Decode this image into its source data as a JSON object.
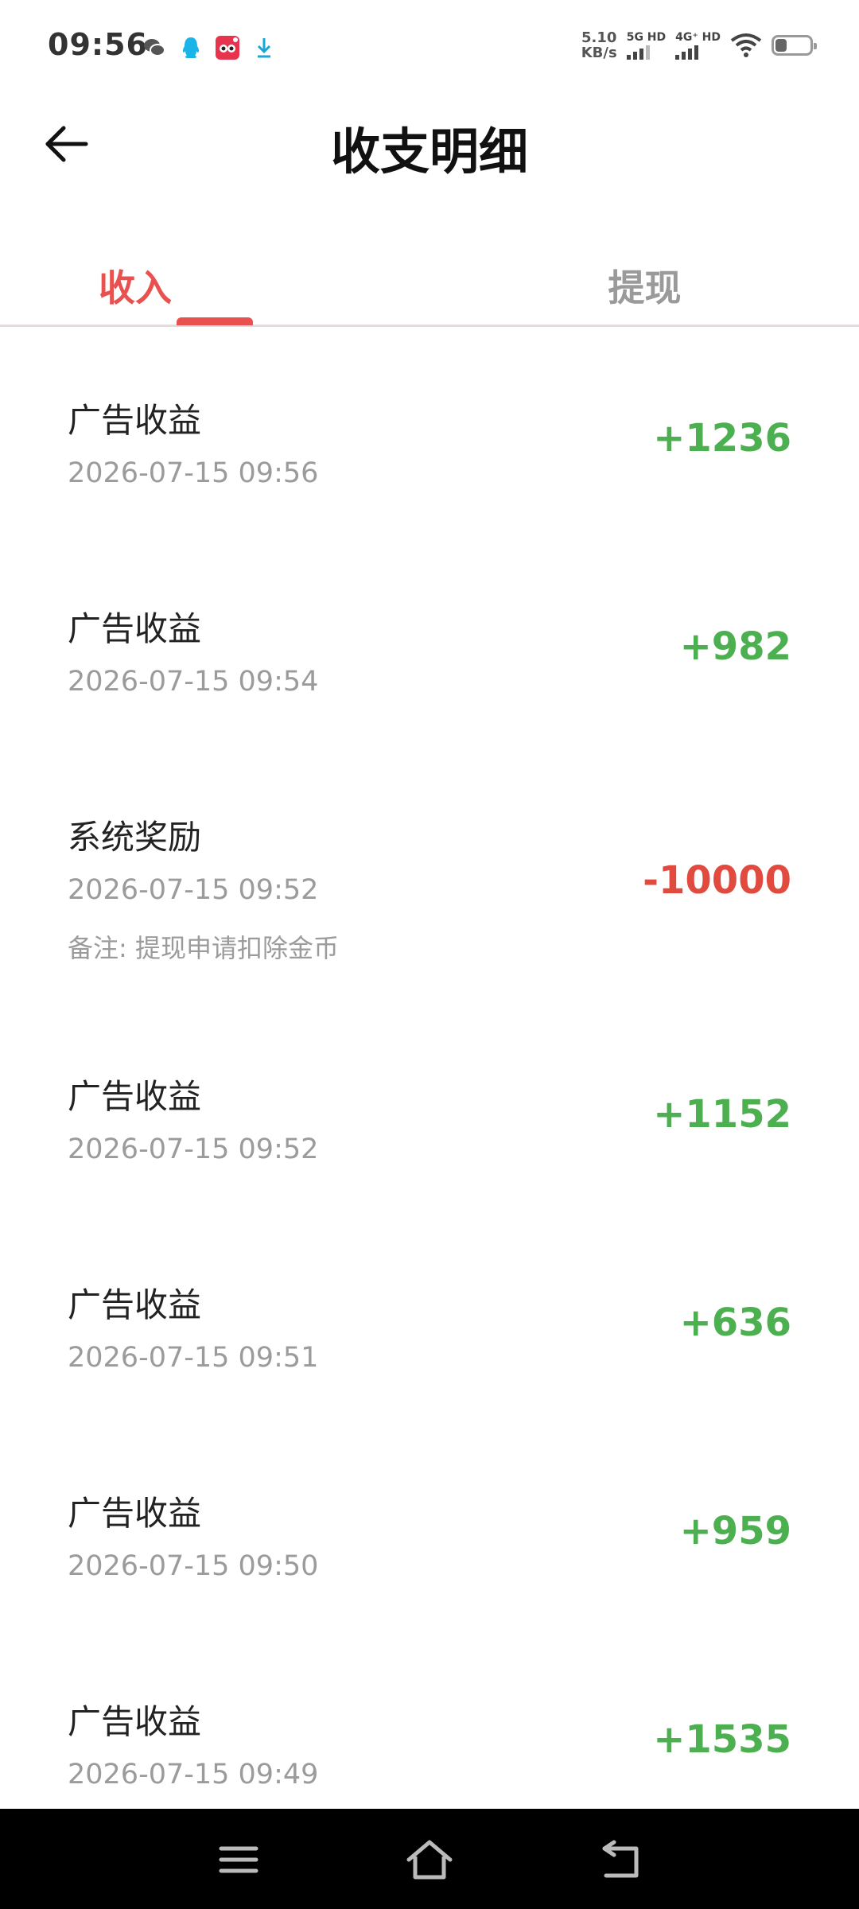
{
  "status_bar": {
    "time": "09:56",
    "icons": [
      "wechat-icon",
      "qq-icon",
      "app-icon",
      "download-icon"
    ],
    "speed_value": "5.10",
    "speed_unit": "KB/s",
    "net1_label": "5G HD",
    "net2_label": "4G⁺ HD"
  },
  "header": {
    "title": "收支明细",
    "back_icon": "arrow-left-icon"
  },
  "tabs": [
    {
      "label": "收入",
      "active": true
    },
    {
      "label": "提现",
      "active": false
    }
  ],
  "colors": {
    "accent": "#e8514f",
    "positive": "#4caf50",
    "negative": "#e04a3f",
    "muted": "#9b9b9b"
  },
  "records": [
    {
      "title": "广告收益",
      "time": "2026-07-15 09:56",
      "amount": "+1236"
    },
    {
      "title": "广告收益",
      "time": "2026-07-15 09:54",
      "amount": "+982"
    },
    {
      "title": "系统奖励",
      "time": "2026-07-15 09:52",
      "amount": "-10000",
      "note": "备注: 提现申请扣除金币"
    },
    {
      "title": "广告收益",
      "time": "2026-07-15 09:52",
      "amount": "+1152"
    },
    {
      "title": "广告收益",
      "time": "2026-07-15 09:51",
      "amount": "+636"
    },
    {
      "title": "广告收益",
      "time": "2026-07-15 09:50",
      "amount": "+959"
    },
    {
      "title": "广告收益",
      "time": "2026-07-15 09:49",
      "amount": "+1535"
    }
  ],
  "nav_bar": {
    "icons": [
      "menu-icon",
      "home-icon",
      "back-icon"
    ]
  }
}
